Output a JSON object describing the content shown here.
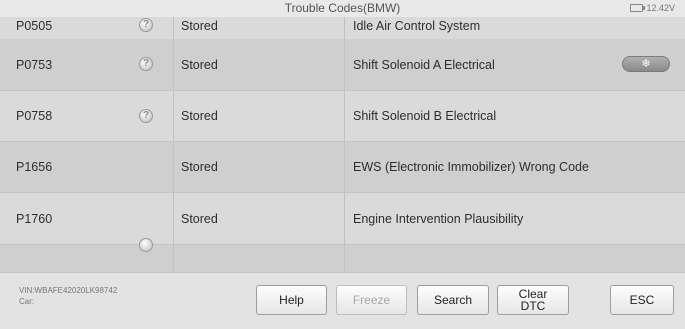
{
  "header": {
    "title": "Trouble Codes(BMW)",
    "battery": "12.42V"
  },
  "table": {
    "rows": [
      {
        "code": "P0505",
        "status": "Stored",
        "description": "Idle Air Control System",
        "help_icon": "?"
      },
      {
        "code": "P0753",
        "status": "Stored",
        "description": "Shift Solenoid A Electrical",
        "help_icon": "?",
        "freeze_icon": "❄"
      },
      {
        "code": "P0758",
        "status": "Stored",
        "description": "Shift Solenoid B Electrical",
        "help_icon": "?"
      },
      {
        "code": "P1656",
        "status": "Stored",
        "description": "EWS (Electronic Immobilizer) Wrong Code"
      },
      {
        "code": "P1760",
        "status": "Stored",
        "description": "Engine Intervention Plausibility"
      }
    ]
  },
  "footer": {
    "vin": "VIN:WBAFE42020LK98742",
    "car": "Car:",
    "buttons": {
      "help": "Help",
      "freeze": "Freeze",
      "search": "Search",
      "clear_dtc": "Clear\nDTC",
      "esc": "ESC"
    }
  },
  "colors": {
    "row_odd": "#dadada",
    "row_even": "#cfcfcf",
    "footer_bg": "#e3e3e3",
    "disabled_text": "#a8a8a8"
  },
  "icons": {
    "help": "question-circle-icon",
    "freeze": "snowflake-icon",
    "battery": "battery-icon"
  }
}
